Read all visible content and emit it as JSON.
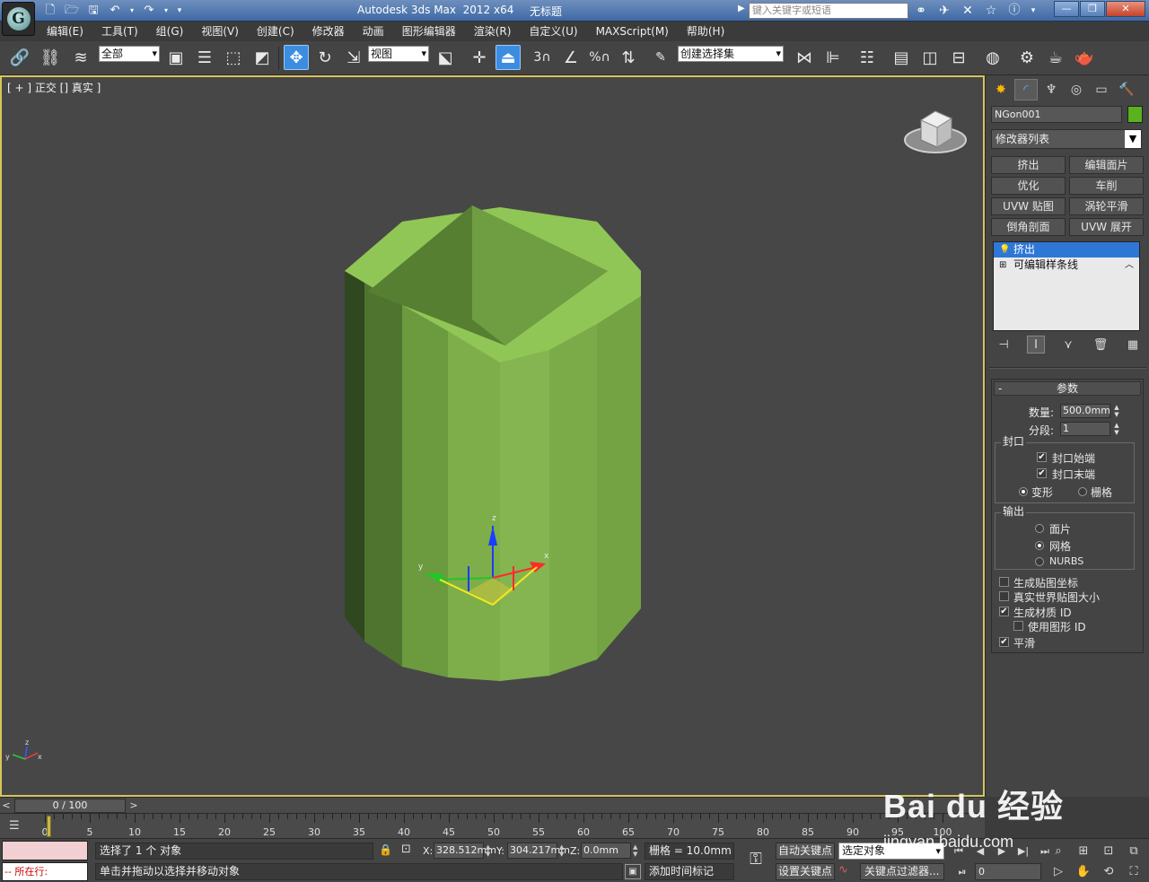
{
  "titlebar": {
    "logo": "3ds-max-logo",
    "title": "Autodesk 3ds Max  2012 x64",
    "doc": "无标题",
    "search_placeholder": "键入关键字或短语",
    "tools": [
      "binoculars-icon",
      "tools-icon",
      "community-icon",
      "favorites-icon",
      "help-icon"
    ]
  },
  "menu": [
    "编辑(E)",
    "工具(T)",
    "组(G)",
    "视图(V)",
    "创建(C)",
    "修改器",
    "动画",
    "图形编辑器",
    "渲染(R)",
    "自定义(U)",
    "MAXScript(M)",
    "帮助(H)"
  ],
  "toolbar": {
    "selection_filter": "全部",
    "ref_coord": "视图",
    "named_selection": "创建选择集",
    "snap_labels": [
      "3",
      "%"
    ]
  },
  "viewport": {
    "label": "[ + ] 正交 [] 真实 ]",
    "object_color": "#8cc350",
    "axis_labels": {
      "x": "x",
      "y": "y",
      "z": "z"
    }
  },
  "cmdpanel": {
    "object_name": "NGon001",
    "object_color_hex": "#5ab31e",
    "modifier_list": "修改器列表",
    "mod_buttons": [
      "挤出",
      "编辑面片",
      "优化",
      "车削",
      "UVW 贴图",
      "涡轮平滑",
      "倒角剖面",
      "UVW 展开"
    ],
    "stack": [
      {
        "label": "挤出",
        "selected": true
      },
      {
        "label": "可编辑样条线",
        "selected": false
      }
    ],
    "params": {
      "title": "参数",
      "collapse": "-",
      "amount_label": "数量:",
      "amount": "500.0mm",
      "segments_label": "分段:",
      "segments": "1",
      "capping_title": "封口",
      "cap_start": "封口始端",
      "cap_end": "封口末端",
      "morph": "变形",
      "grid": "栅格",
      "output_title": "输出",
      "patch": "面片",
      "mesh": "网格",
      "nurbs": "NURBS",
      "gen_map_coords": "生成贴图坐标",
      "real_world": "真实世界贴图大小",
      "gen_mat_ids": "生成材质 ID",
      "use_shape_ids": "使用图形 ID",
      "smooth": "平滑",
      "check": "✔"
    }
  },
  "timeslider": {
    "position": "0 / 100",
    "ticks": [
      0,
      5,
      10,
      15,
      20,
      25,
      30,
      35,
      40,
      45,
      50,
      55,
      60,
      65,
      70,
      75,
      80,
      85,
      90,
      95,
      100
    ]
  },
  "status": {
    "listener": "-- 所在行:",
    "selection": "选择了 1 个 对象",
    "prompt": "单击并拖动以选择并移动对象",
    "x_label": "X:",
    "x": "328.512mm",
    "y_label": "Y:",
    "y": "304.217mm",
    "z_label": "Z:",
    "z": "0.0mm",
    "grid": "栅格 = 10.0mm",
    "add_time_tag": "添加时间标记",
    "auto_key": "自动关键点",
    "set_key": "设置关键点",
    "selected_set": "选定对象",
    "key_filters": "关键点过滤器...",
    "frame": "0"
  },
  "watermark": {
    "text": "Bai du 经验",
    "url": "jingyan.baidu.com"
  }
}
